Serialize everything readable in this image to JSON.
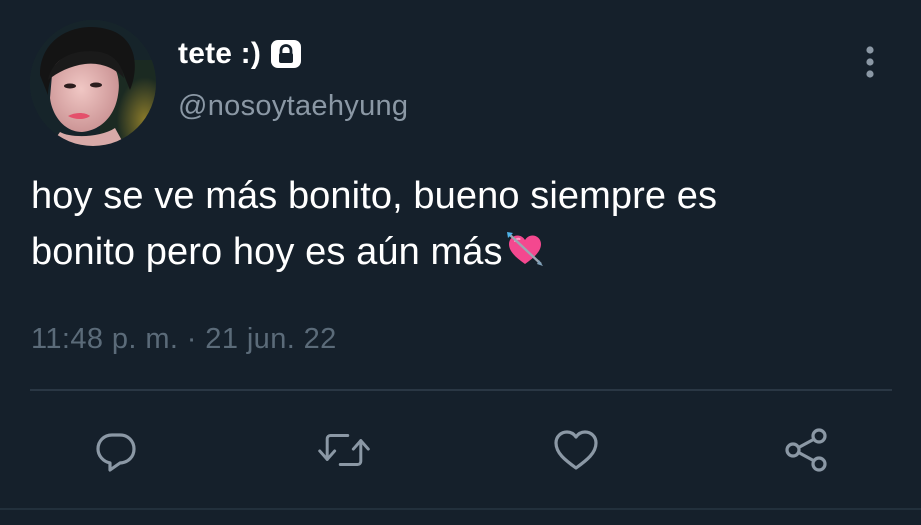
{
  "tweet": {
    "author": {
      "display_name": "tete :)",
      "handle": "@nosoytaehyung",
      "protected": true,
      "protected_icon": "lock-icon",
      "avatar": "profile-photo"
    },
    "text_line_1": "hoy se ve más bonito, bueno siempre es",
    "text_line_2": "bonito pero hoy es aún más",
    "emoji": "heart-with-arrow-emoji",
    "timestamp": "11:48 p. m. · 21 jun. 22",
    "more_icon": "more-vertical-icon",
    "actions": [
      {
        "name": "reply",
        "icon": "reply-icon"
      },
      {
        "name": "retweet",
        "icon": "retweet-icon"
      },
      {
        "name": "like",
        "icon": "heart-icon"
      },
      {
        "name": "share",
        "icon": "share-icon"
      }
    ]
  },
  "colors": {
    "background": "#15202b",
    "primary_text": "#ffffff",
    "secondary_text": "#8b98a5",
    "muted_text": "#5b6b79",
    "icon": "#8b98a5",
    "divider": "#2a3744"
  }
}
